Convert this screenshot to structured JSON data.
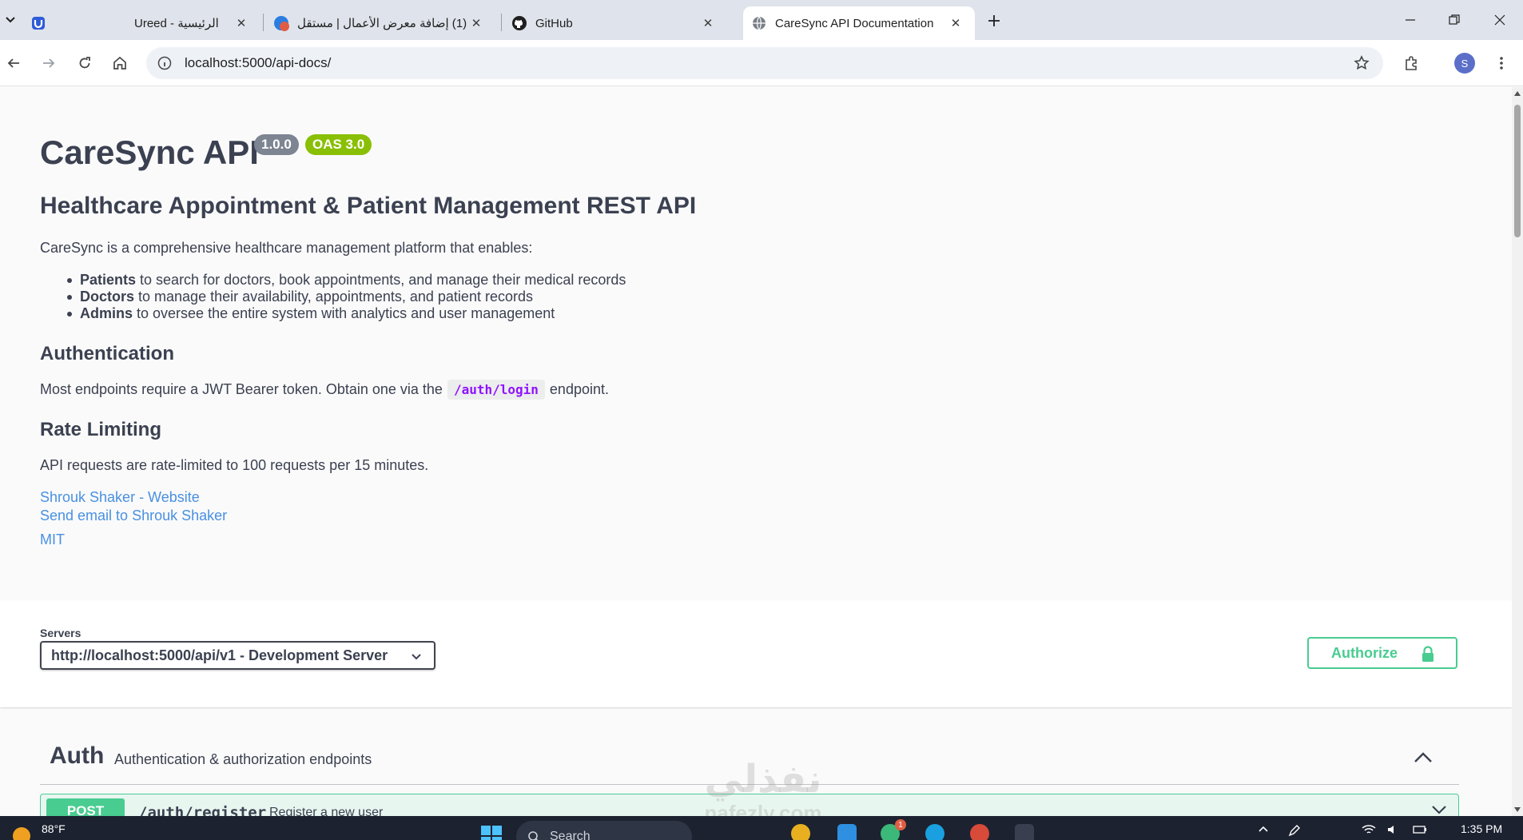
{
  "browser": {
    "tabs": [
      {
        "title": "Ureed - الرئيسية",
        "icon": "ureed-icon",
        "active": false
      },
      {
        "title": "(1) إضافة معرض الأعمال | مستقل",
        "icon": "mostaql-icon",
        "badge": "1",
        "active": false
      },
      {
        "title": "GitHub",
        "icon": "github-icon",
        "active": false
      },
      {
        "title": "CareSync API Documentation",
        "icon": "globe-icon",
        "active": true
      }
    ],
    "url": "localhost:5000/api-docs/",
    "profile_initial": "S"
  },
  "info": {
    "title": "CareSync API",
    "version": "1.0.0",
    "oas": "OAS 3.0",
    "subtitle": "Healthcare Appointment & Patient Management REST API",
    "intro": "CareSync is a comprehensive healthcare management platform that enables:",
    "bullets": [
      {
        "strong": "Patients",
        "text": " to search for doctors, book appointments, and manage their medical records"
      },
      {
        "strong": "Doctors",
        "text": " to manage their availability, appointments, and patient records"
      },
      {
        "strong": "Admins",
        "text": " to oversee the entire system with analytics and user management"
      }
    ],
    "auth_heading": "Authentication",
    "auth_text_before": "Most endpoints require a JWT Bearer token. Obtain one via the",
    "auth_code": "/auth/login",
    "auth_text_after": "endpoint.",
    "rate_heading": "Rate Limiting",
    "rate_text": "API requests are rate-limited to 100 requests per 15 minutes.",
    "links": {
      "website": "Shrouk Shaker - Website",
      "email": "Send email to Shrouk Shaker",
      "license": "MIT"
    }
  },
  "servers": {
    "label": "Servers",
    "selected": "http://localhost:5000/api/v1 - Development Server"
  },
  "authorize_label": "Authorize",
  "tag": {
    "name": "Auth",
    "description": "Authentication & authorization endpoints",
    "operations": [
      {
        "method": "POST",
        "path": "/auth/register",
        "summary": "Register a new user"
      }
    ]
  },
  "watermark": {
    "main": "نفذلي",
    "sub": "nafezly.com"
  },
  "taskbar": {
    "temperature": "88°F",
    "search_placeholder": "Search",
    "time": "1:35 PM",
    "whatsapp_badge": "1"
  },
  "colors": {
    "post_green": "#49cc90",
    "oas_green": "#89bf04",
    "version_gray": "#7d8492",
    "link_blue": "#4990e2",
    "code_purple": "#9012fe"
  }
}
